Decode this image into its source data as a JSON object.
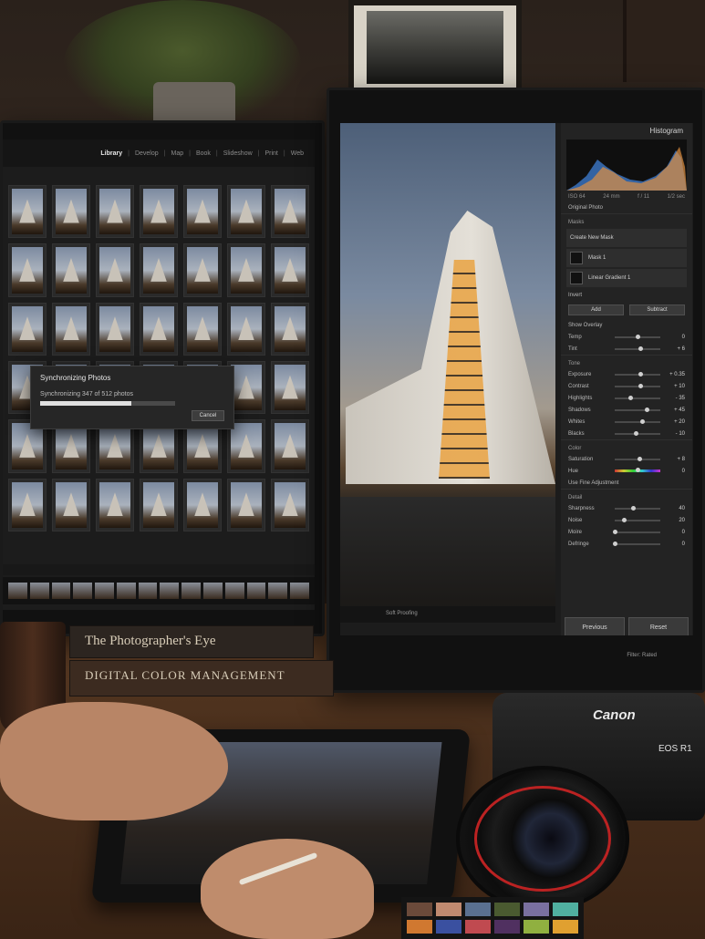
{
  "left_monitor": {
    "modules": [
      "Library",
      "Develop",
      "Map",
      "Book",
      "Slideshow",
      "Print",
      "Web"
    ],
    "active_module": "Library",
    "sync_dialog": {
      "title": "Synchronizing Photos",
      "status": "Synchronizing 347 of 512 photos",
      "done": 347,
      "total": 512,
      "cancel_label": "Cancel"
    }
  },
  "right_monitor": {
    "panel_title": "Histogram",
    "exif": {
      "iso": "ISO 64",
      "focal": "24 mm",
      "aperture": "f / 11",
      "shutter": "1/2 sec"
    },
    "original_photo_label": "Original Photo",
    "masks": {
      "header": "Masks",
      "create_label": "Create New Mask",
      "mask_name": "Mask 1",
      "gradient_name": "Linear Gradient 1",
      "invert_label": "Invert",
      "add_label": "Add",
      "subtract_label": "Subtract",
      "overlay_label": "Show Overlay"
    },
    "white_balance": [
      {
        "label": "Temp",
        "value": "0",
        "pos": 0.5
      },
      {
        "label": "Tint",
        "value": "+ 6",
        "pos": 0.55
      }
    ],
    "tone_header": "Tone",
    "tone": [
      {
        "label": "Exposure",
        "value": "+ 0.35",
        "pos": 0.56
      },
      {
        "label": "Contrast",
        "value": "+ 10",
        "pos": 0.55
      },
      {
        "label": "Highlights",
        "value": "- 35",
        "pos": 0.33
      },
      {
        "label": "Shadows",
        "value": "+ 45",
        "pos": 0.7
      },
      {
        "label": "Whites",
        "value": "+ 20",
        "pos": 0.6
      },
      {
        "label": "Blacks",
        "value": "- 10",
        "pos": 0.45
      }
    ],
    "color_header": "Color",
    "color": [
      {
        "label": "Saturation",
        "value": "+ 8",
        "pos": 0.54
      },
      {
        "label": "Hue",
        "value": "0",
        "pos": 0.5
      }
    ],
    "fine_adjust_label": "Use Fine Adjustment",
    "detail_header": "Detail",
    "detail": [
      {
        "label": "Sharpness",
        "value": "40",
        "pos": 0.4
      },
      {
        "label": "Noise",
        "value": "20",
        "pos": 0.2
      },
      {
        "label": "Moire",
        "value": "0",
        "pos": 0.0
      },
      {
        "label": "Defringe",
        "value": "0",
        "pos": 0.0
      }
    ],
    "previous_label": "Previous",
    "reset_label": "Reset",
    "soft_proofing_label": "Soft Proofing",
    "filter_label": "Filter:",
    "filter_value": "Rated"
  },
  "desk": {
    "book_top_title": "The Photographer's Eye",
    "book_bottom_title": "DIGITAL COLOR MANAGEMENT",
    "camera_brand": "Canon",
    "camera_model": "EOS R1"
  },
  "colors": {
    "accent_orange": "#e06a2a",
    "histogram_blue": "#3c78c8",
    "histogram_orange": "#e09040"
  }
}
